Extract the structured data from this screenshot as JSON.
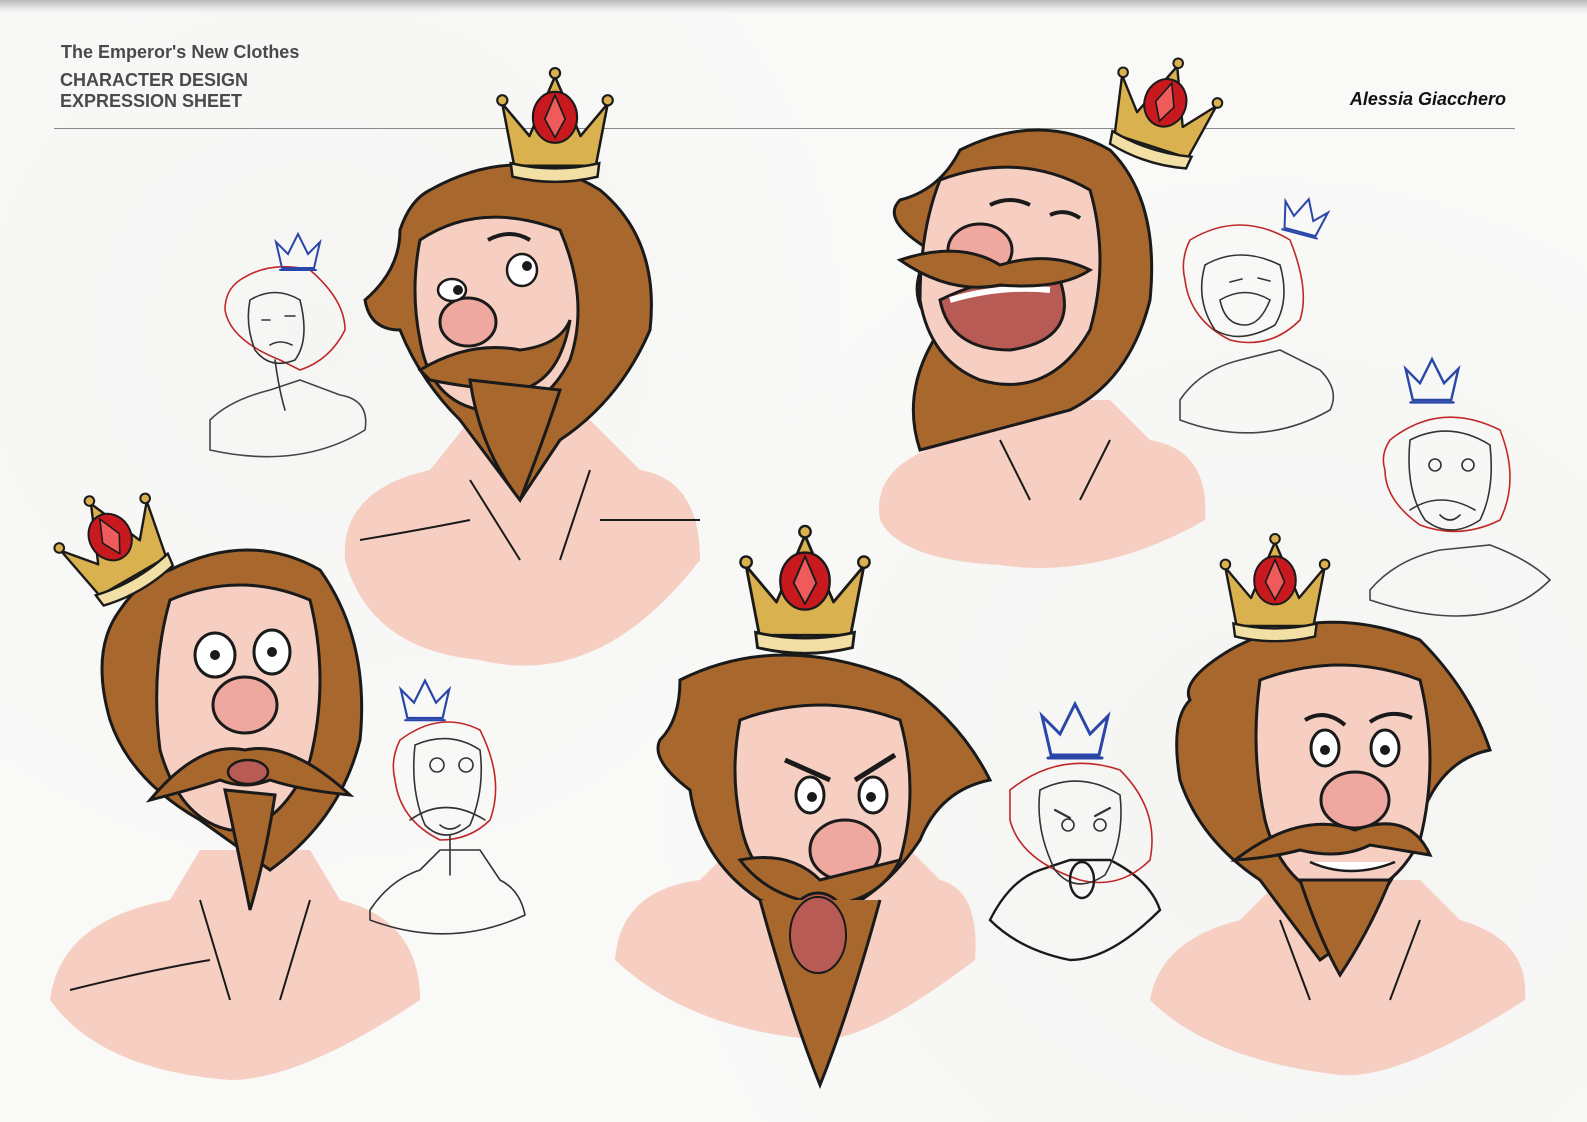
{
  "header": {
    "story_title": "The Emperor's New Clothes",
    "line1": "CHARACTER DESIGN",
    "line2": "EXPRESSION SHEET",
    "author": "Alessia Giacchero"
  },
  "colors": {
    "skin": "#f6cfc2",
    "skin_shadow": "#efb7a8",
    "hair": "#a8682d",
    "hair_dark": "#8a5220",
    "crown_gold": "#d9b14f",
    "crown_red": "#c8191e",
    "sketch_red": "#c02828",
    "sketch_blue": "#2a46a8",
    "line": "#1a1a1a"
  },
  "figures": [
    {
      "kind": "color-head",
      "expression": "skeptical"
    },
    {
      "kind": "color-head",
      "expression": "laughing"
    },
    {
      "kind": "color-head",
      "expression": "shocked"
    },
    {
      "kind": "color-head",
      "expression": "angry-shouting"
    },
    {
      "kind": "color-head",
      "expression": "worried"
    },
    {
      "kind": "sketch",
      "expression": "skeptical"
    },
    {
      "kind": "sketch",
      "expression": "laughing"
    },
    {
      "kind": "sketch",
      "expression": "surprised"
    },
    {
      "kind": "sketch",
      "expression": "shocked"
    },
    {
      "kind": "sketch",
      "expression": "angry-shouting"
    }
  ]
}
